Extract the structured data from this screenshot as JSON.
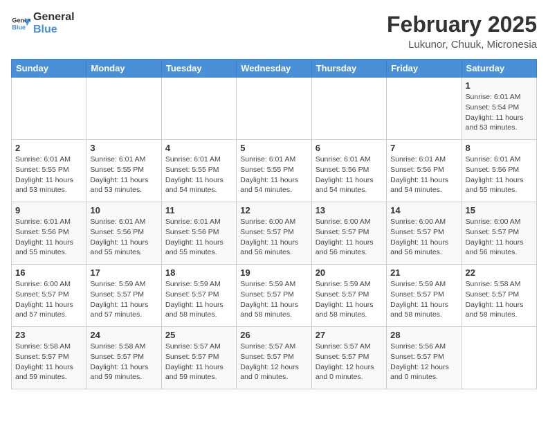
{
  "header": {
    "logo_general": "General",
    "logo_blue": "Blue",
    "month": "February 2025",
    "location": "Lukunor, Chuuk, Micronesia"
  },
  "weekdays": [
    "Sunday",
    "Monday",
    "Tuesday",
    "Wednesday",
    "Thursday",
    "Friday",
    "Saturday"
  ],
  "weeks": [
    [
      {
        "day": "",
        "info": ""
      },
      {
        "day": "",
        "info": ""
      },
      {
        "day": "",
        "info": ""
      },
      {
        "day": "",
        "info": ""
      },
      {
        "day": "",
        "info": ""
      },
      {
        "day": "",
        "info": ""
      },
      {
        "day": "1",
        "info": "Sunrise: 6:01 AM\nSunset: 5:54 PM\nDaylight: 11 hours\nand 53 minutes."
      }
    ],
    [
      {
        "day": "2",
        "info": "Sunrise: 6:01 AM\nSunset: 5:55 PM\nDaylight: 11 hours\nand 53 minutes."
      },
      {
        "day": "3",
        "info": "Sunrise: 6:01 AM\nSunset: 5:55 PM\nDaylight: 11 hours\nand 53 minutes."
      },
      {
        "day": "4",
        "info": "Sunrise: 6:01 AM\nSunset: 5:55 PM\nDaylight: 11 hours\nand 54 minutes."
      },
      {
        "day": "5",
        "info": "Sunrise: 6:01 AM\nSunset: 5:55 PM\nDaylight: 11 hours\nand 54 minutes."
      },
      {
        "day": "6",
        "info": "Sunrise: 6:01 AM\nSunset: 5:56 PM\nDaylight: 11 hours\nand 54 minutes."
      },
      {
        "day": "7",
        "info": "Sunrise: 6:01 AM\nSunset: 5:56 PM\nDaylight: 11 hours\nand 54 minutes."
      },
      {
        "day": "8",
        "info": "Sunrise: 6:01 AM\nSunset: 5:56 PM\nDaylight: 11 hours\nand 55 minutes."
      }
    ],
    [
      {
        "day": "9",
        "info": "Sunrise: 6:01 AM\nSunset: 5:56 PM\nDaylight: 11 hours\nand 55 minutes."
      },
      {
        "day": "10",
        "info": "Sunrise: 6:01 AM\nSunset: 5:56 PM\nDaylight: 11 hours\nand 55 minutes."
      },
      {
        "day": "11",
        "info": "Sunrise: 6:01 AM\nSunset: 5:56 PM\nDaylight: 11 hours\nand 55 minutes."
      },
      {
        "day": "12",
        "info": "Sunrise: 6:00 AM\nSunset: 5:57 PM\nDaylight: 11 hours\nand 56 minutes."
      },
      {
        "day": "13",
        "info": "Sunrise: 6:00 AM\nSunset: 5:57 PM\nDaylight: 11 hours\nand 56 minutes."
      },
      {
        "day": "14",
        "info": "Sunrise: 6:00 AM\nSunset: 5:57 PM\nDaylight: 11 hours\nand 56 minutes."
      },
      {
        "day": "15",
        "info": "Sunrise: 6:00 AM\nSunset: 5:57 PM\nDaylight: 11 hours\nand 56 minutes."
      }
    ],
    [
      {
        "day": "16",
        "info": "Sunrise: 6:00 AM\nSunset: 5:57 PM\nDaylight: 11 hours\nand 57 minutes."
      },
      {
        "day": "17",
        "info": "Sunrise: 5:59 AM\nSunset: 5:57 PM\nDaylight: 11 hours\nand 57 minutes."
      },
      {
        "day": "18",
        "info": "Sunrise: 5:59 AM\nSunset: 5:57 PM\nDaylight: 11 hours\nand 58 minutes."
      },
      {
        "day": "19",
        "info": "Sunrise: 5:59 AM\nSunset: 5:57 PM\nDaylight: 11 hours\nand 58 minutes."
      },
      {
        "day": "20",
        "info": "Sunrise: 5:59 AM\nSunset: 5:57 PM\nDaylight: 11 hours\nand 58 minutes."
      },
      {
        "day": "21",
        "info": "Sunrise: 5:59 AM\nSunset: 5:57 PM\nDaylight: 11 hours\nand 58 minutes."
      },
      {
        "day": "22",
        "info": "Sunrise: 5:58 AM\nSunset: 5:57 PM\nDaylight: 11 hours\nand 58 minutes."
      }
    ],
    [
      {
        "day": "23",
        "info": "Sunrise: 5:58 AM\nSunset: 5:57 PM\nDaylight: 11 hours\nand 59 minutes."
      },
      {
        "day": "24",
        "info": "Sunrise: 5:58 AM\nSunset: 5:57 PM\nDaylight: 11 hours\nand 59 minutes."
      },
      {
        "day": "25",
        "info": "Sunrise: 5:57 AM\nSunset: 5:57 PM\nDaylight: 11 hours\nand 59 minutes."
      },
      {
        "day": "26",
        "info": "Sunrise: 5:57 AM\nSunset: 5:57 PM\nDaylight: 12 hours\nand 0 minutes."
      },
      {
        "day": "27",
        "info": "Sunrise: 5:57 AM\nSunset: 5:57 PM\nDaylight: 12 hours\nand 0 minutes."
      },
      {
        "day": "28",
        "info": "Sunrise: 5:56 AM\nSunset: 5:57 PM\nDaylight: 12 hours\nand 0 minutes."
      },
      {
        "day": "",
        "info": ""
      }
    ]
  ]
}
